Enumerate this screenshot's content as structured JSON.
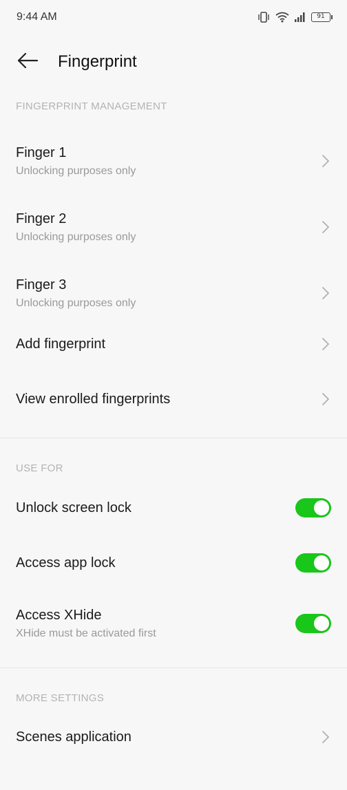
{
  "status_bar": {
    "time": "9:44 AM",
    "battery": "91"
  },
  "header": {
    "title": "Fingerprint"
  },
  "sections": {
    "management": {
      "header": "FINGERPRINT MANAGEMENT",
      "items": [
        {
          "title": "Finger 1",
          "subtitle": "Unlocking purposes only"
        },
        {
          "title": "Finger 2",
          "subtitle": "Unlocking purposes only"
        },
        {
          "title": "Finger 3",
          "subtitle": "Unlocking purposes only"
        },
        {
          "title": "Add fingerprint"
        },
        {
          "title": "View enrolled fingerprints"
        }
      ]
    },
    "use_for": {
      "header": "USE FOR",
      "items": [
        {
          "title": "Unlock screen lock",
          "enabled": true
        },
        {
          "title": "Access app lock",
          "enabled": true
        },
        {
          "title": "Access XHide",
          "subtitle": "XHide must be activated first",
          "enabled": true
        }
      ]
    },
    "more": {
      "header": "MORE SETTINGS",
      "items": [
        {
          "title": "Scenes application"
        }
      ]
    }
  },
  "colors": {
    "toggle_on": "#19c61a",
    "background": "#f7f7f7",
    "section_header": "#b3b3b3"
  },
  "icons": {
    "back": "arrow-left-icon",
    "chevron": "chevron-right-icon"
  }
}
